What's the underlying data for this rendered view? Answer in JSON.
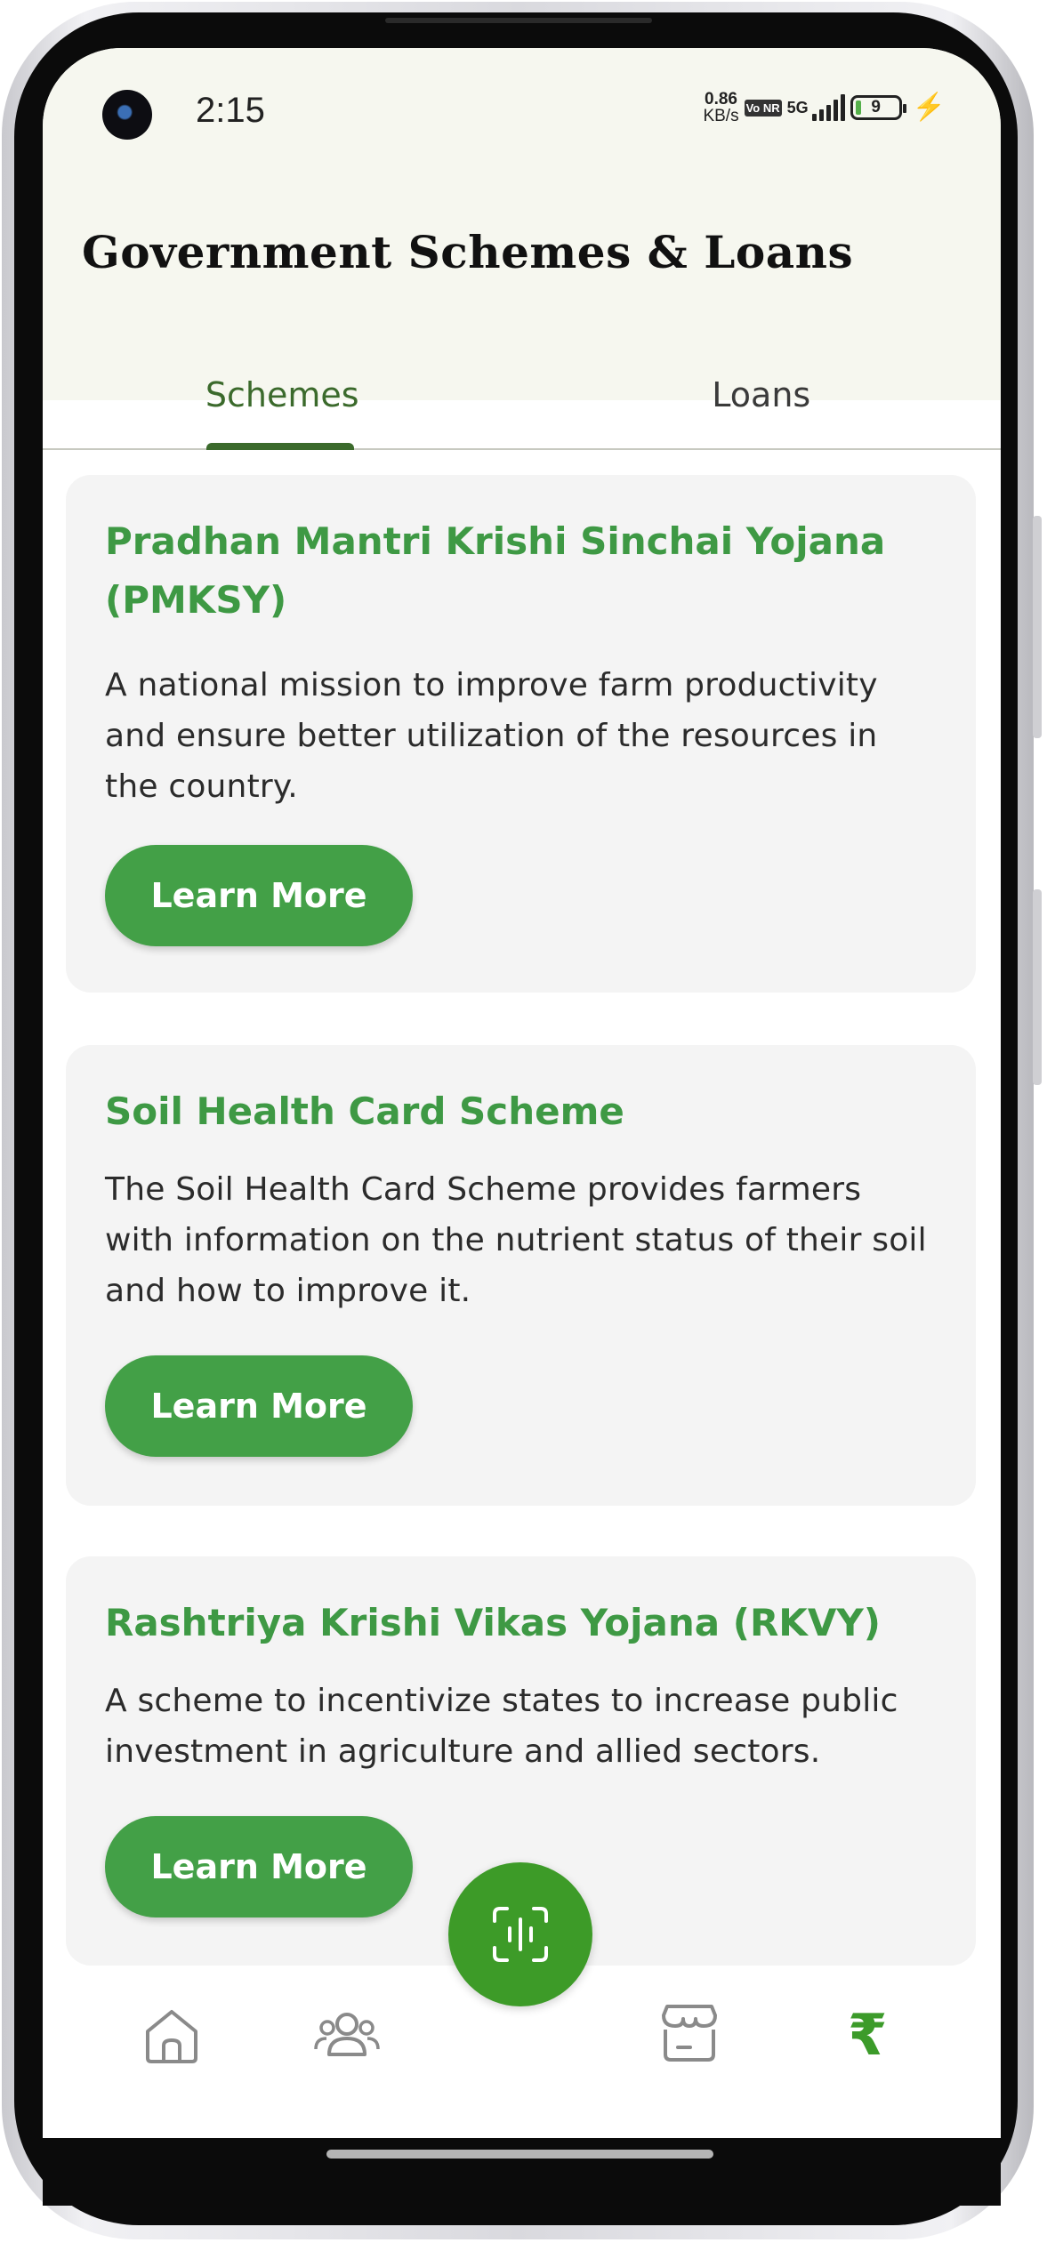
{
  "status_bar": {
    "time": "2:15",
    "net_speed_value": "0.86",
    "net_speed_unit": "KB/s",
    "volte": "Vo NR",
    "network": "5G",
    "battery": "9"
  },
  "header": {
    "title": "Government Schemes & Loans"
  },
  "tabs": [
    {
      "label": "Schemes",
      "active": true
    },
    {
      "label": "Loans",
      "active": false
    }
  ],
  "schemes": [
    {
      "title": "Pradhan Mantri Krishi Sinchai Yojana (PMKSY)",
      "description": "A national mission to improve farm productivity and ensure better utilization of the resources in the country.",
      "button": "Learn More"
    },
    {
      "title": "Soil Health Card Scheme",
      "description": "The Soil Health Card Scheme provides farmers with information on the nutrient status of their soil and how to improve it.",
      "button": "Learn More"
    },
    {
      "title": "Rashtriya Krishi Vikas Yojana (RKVY)",
      "description": "A scheme to incentivize states to increase public investment in agriculture and allied sectors.",
      "button": "Learn More"
    }
  ],
  "bottom_nav": {
    "items": [
      "home-icon",
      "community-icon",
      "voice-assistant-icon",
      "store-icon",
      "rupee-icon"
    ],
    "active": "rupee-icon",
    "rupee_symbol": "₹"
  },
  "colors": {
    "accent_green": "#43a047",
    "title_green": "#3e9944",
    "tab_active": "#3b6a2c",
    "header_bg": "#f6f7ef",
    "card_bg": "#f4f4f4"
  }
}
